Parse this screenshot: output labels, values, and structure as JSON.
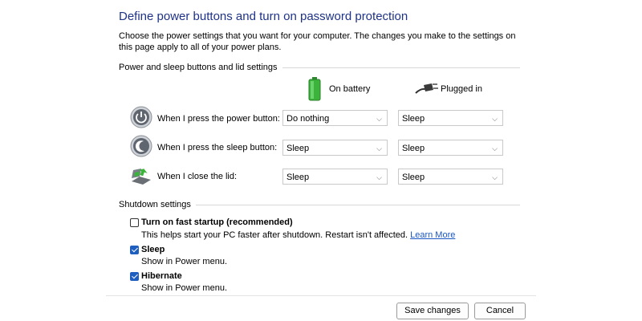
{
  "header": {
    "title": "Define power buttons and turn on password protection",
    "description": "Choose the power settings that you want for your computer. The changes you make to the settings on this page apply to all of your power plans."
  },
  "power_section": {
    "label": "Power and sleep buttons and lid settings",
    "columns": {
      "on_battery": "On battery",
      "plugged_in": "Plugged in"
    },
    "rows": [
      {
        "label": "When I press the power button:",
        "icon": "power-button-icon",
        "battery": "Do nothing",
        "plugged": "Sleep"
      },
      {
        "label": "When I press the sleep button:",
        "icon": "sleep-button-icon",
        "battery": "Sleep",
        "plugged": "Sleep"
      },
      {
        "label": "When I close the lid:",
        "icon": "laptop-lid-icon",
        "battery": "Sleep",
        "plugged": "Sleep"
      }
    ]
  },
  "shutdown_section": {
    "label": "Shutdown settings",
    "options": [
      {
        "title": "Turn on fast startup (recommended)",
        "desc": "This helps start your PC faster after shutdown. Restart isn't affected.",
        "link": "Learn More",
        "checked": false
      },
      {
        "title": "Sleep",
        "desc": "Show in Power menu.",
        "checked": true
      },
      {
        "title": "Hibernate",
        "desc": "Show in Power menu.",
        "checked": true
      }
    ]
  },
  "footer": {
    "save": "Save changes",
    "cancel": "Cancel"
  },
  "colors": {
    "title": "#1e3287",
    "link": "#1a56c4",
    "checkbox": "#1f5fbf",
    "battery": "#3cb43c"
  }
}
